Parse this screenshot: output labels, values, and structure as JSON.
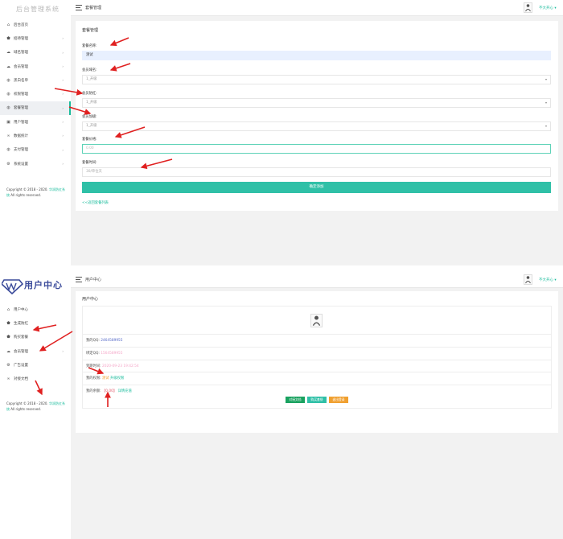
{
  "top": {
    "logo_text": "后台管理系统",
    "breadcrumb": "套餐管理",
    "user_menu": "不大开心 ▾",
    "nav": [
      {
        "icon": "home-icon",
        "glyph": "⌂",
        "label": "后台首页",
        "arrow": ""
      },
      {
        "icon": "shield-icon",
        "glyph": "⬟",
        "label": "招待管理",
        "arrow": "›"
      },
      {
        "icon": "cloud-icon",
        "glyph": "☁",
        "label": "域名管理",
        "arrow": "›"
      },
      {
        "icon": "cloud-icon",
        "glyph": "☁",
        "label": "会员管理",
        "arrow": "›"
      },
      {
        "icon": "globe-icon",
        "glyph": "◍",
        "label": "黑白名单",
        "arrow": "›"
      },
      {
        "icon": "globe-icon",
        "glyph": "◍",
        "label": "权限管理",
        "arrow": "›"
      },
      {
        "icon": "globe-icon",
        "glyph": "◍",
        "label": "套餐管理",
        "arrow": "›",
        "active": true
      },
      {
        "icon": "user-icon",
        "glyph": "▣",
        "label": "用户管理",
        "arrow": "›"
      },
      {
        "icon": "link-icon",
        "glyph": "∞",
        "label": "数据统计",
        "arrow": "›"
      },
      {
        "icon": "globe-icon",
        "glyph": "◍",
        "label": "支付管理",
        "arrow": "›"
      },
      {
        "icon": "gear-icon",
        "glyph": "⚙",
        "label": "系统设置",
        "arrow": "›"
      }
    ],
    "copyright_prefix": "Copyright © 2018 - 2020.",
    "copyright_link": "华润防红系统",
    "copyright_suffix": "All rights reserved.",
    "card_title": "套餐管理",
    "form": {
      "name_label": "套餐名称:",
      "name_value": "测试",
      "domain_label": "会员域名:",
      "domain_value": "1_开级",
      "anti_label": "会员防红:",
      "anti_value": "1_开级",
      "level_label": "会员加级:",
      "level_value": "1_开级",
      "price_label": "套餐价格:",
      "price_value": "0.00",
      "time_label": "套餐时间:",
      "time_placeholder": "30/单位天",
      "submit_label": "确定添加",
      "back_link": "<<返回套餐列表"
    }
  },
  "bottom": {
    "logo_text": "用户中心",
    "breadcrumb": "用户中心",
    "user_menu": "不大开心 ▾",
    "nav": [
      {
        "icon": "home-icon",
        "glyph": "⌂",
        "label": "用户中心"
      },
      {
        "icon": "shield-icon",
        "glyph": "⬟",
        "label": "生成防红"
      },
      {
        "icon": "shield-icon",
        "glyph": "⬟",
        "label": "购买套餐"
      },
      {
        "icon": "cloud-icon",
        "glyph": "☁",
        "label": "会员管理",
        "arrow": "›"
      },
      {
        "icon": "gear-icon",
        "glyph": "⚙",
        "label": "广告设置"
      },
      {
        "icon": "link-icon",
        "glyph": "∞",
        "label": "对接文档"
      }
    ],
    "copyright_prefix": "Copyright © 2018 - 2020.",
    "copyright_link": "华润防红系统",
    "copyright_suffix": "All rights reserved.",
    "card_title": "用户中心",
    "info": {
      "qq_label": "我的QQ:",
      "qq_value": "2464589955",
      "bind_label": "绑定QQ:",
      "bind_value": "1564589955",
      "login_label": "到期时间:",
      "login_value": "2020-09-23 19:42:54",
      "perm_label": "我的权限:",
      "perm_value": "测试",
      "perm_link": "升级权限",
      "balance_label": "我的余额:",
      "balance_value": "【0.00】",
      "balance_link": "详情充值"
    },
    "buttons": {
      "doc": "对接文档",
      "buy": "购买套餐",
      "logout": "退出登录"
    }
  },
  "colors": {
    "accent": "#1abc9c",
    "submit": "#2fc0a7",
    "arrow": "#e02020",
    "btn_doc": "#1aa260",
    "btn_buy": "#2fc0a7",
    "btn_logout": "#f0a030"
  }
}
